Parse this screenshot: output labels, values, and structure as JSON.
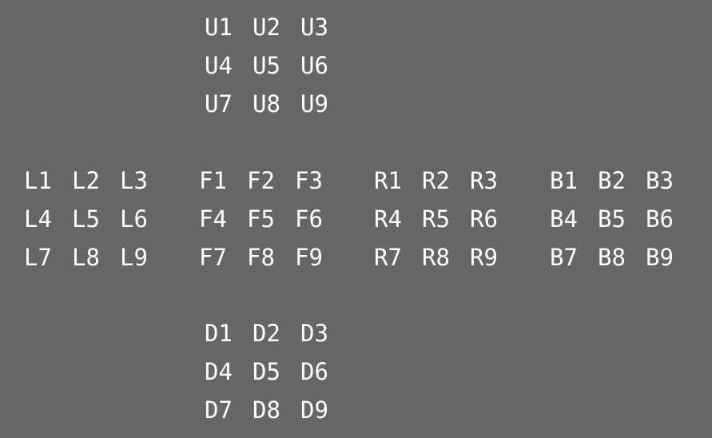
{
  "colors": {
    "background": "#666666",
    "text": "#ffffff"
  },
  "faces": {
    "U": [
      [
        "U1",
        "U2",
        "U3"
      ],
      [
        "U4",
        "U5",
        "U6"
      ],
      [
        "U7",
        "U8",
        "U9"
      ]
    ],
    "L": [
      [
        "L1",
        "L2",
        "L3"
      ],
      [
        "L4",
        "L5",
        "L6"
      ],
      [
        "L7",
        "L8",
        "L9"
      ]
    ],
    "F": [
      [
        "F1",
        "F2",
        "F3"
      ],
      [
        "F4",
        "F5",
        "F6"
      ],
      [
        "F7",
        "F8",
        "F9"
      ]
    ],
    "R": [
      [
        "R1",
        "R2",
        "R3"
      ],
      [
        "R4",
        "R5",
        "R6"
      ],
      [
        "R7",
        "R8",
        "R9"
      ]
    ],
    "B": [
      [
        "B1",
        "B2",
        "B3"
      ],
      [
        "B4",
        "B5",
        "B6"
      ],
      [
        "B7",
        "B8",
        "B9"
      ]
    ],
    "D": [
      [
        "D1",
        "D2",
        "D3"
      ],
      [
        "D4",
        "D5",
        "D6"
      ],
      [
        "D7",
        "D8",
        "D9"
      ]
    ]
  }
}
